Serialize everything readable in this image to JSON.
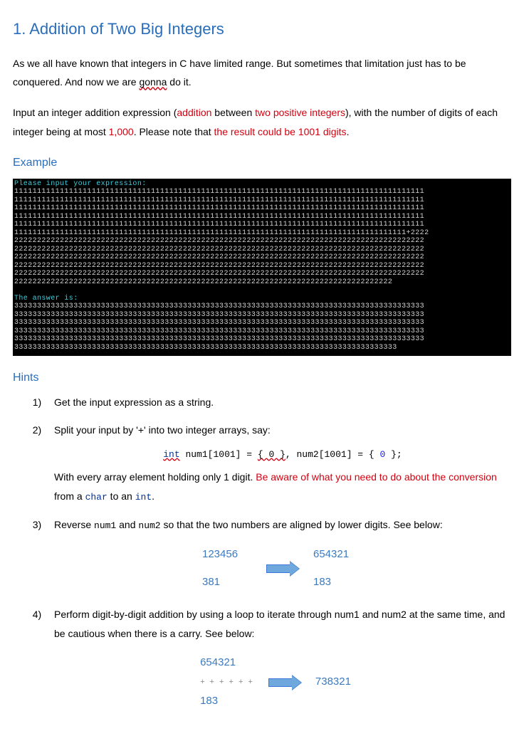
{
  "title": "1. Addition of Two Big Integers",
  "para1_a": "As we all have known that integers in C have limited range. But sometimes that limitation just has to be conquered. And now we are ",
  "para1_squiggle": "gonna",
  "para1_b": " do it.",
  "para2_a": "Input an integer addition expression (",
  "para2_red1": "addition",
  "para2_b": " between ",
  "para2_red2": "two positive integers",
  "para2_c": "), with the number of digits of each integer being at most ",
  "para2_red3": "1,000",
  "para2_d": ". Please note that ",
  "para2_red4": "the result could be 1001 digits",
  "para2_e": ".",
  "example_heading": "Example",
  "terminal": {
    "line_prompt": "Please input your expression:",
    "ones": "111111111111111111111111111111111111111111111111111111111111111111111111111111111111111111\n111111111111111111111111111111111111111111111111111111111111111111111111111111111111111111\n111111111111111111111111111111111111111111111111111111111111111111111111111111111111111111\n111111111111111111111111111111111111111111111111111111111111111111111111111111111111111111\n111111111111111111111111111111111111111111111111111111111111111111111111111111111111111111\n11111111111111111111111111111111111111111111111111111111111111111111111111111111111111+2222\n222222222222222222222222222222222222222222222222222222222222222222222222222222222222222222\n222222222222222222222222222222222222222222222222222222222222222222222222222222222222222222\n222222222222222222222222222222222222222222222222222222222222222222222222222222222222222222\n222222222222222222222222222222222222222222222222222222222222222222222222222222222222222222\n222222222222222222222222222222222222222222222222222222222222222222222222222222222222222222\n22222222222222222222222222222222222222222222222222222222222222222222222222222222222",
    "line_answer": "The answer is:",
    "threes": "333333333333333333333333333333333333333333333333333333333333333333333333333333333333333333\n333333333333333333333333333333333333333333333333333333333333333333333333333333333333333333\n333333333333333333333333333333333333333333333333333333333333333333333333333333333333333333\n333333333333333333333333333333333333333333333333333333333333333333333333333333333333333333\n333333333333333333333333333333333333333333333333333333333333333333333333333333333333333333\n333333333333333333333333333333333333333333333333333333333333333333333333333333333333"
  },
  "hints_heading": "Hints",
  "hints": {
    "h1": "Get the input expression as a string.",
    "h2_a": "Split your input by '+' into two integer arrays, say:",
    "h2_code_kw": "int",
    "h2_code_a": " num1[1001] = ",
    "h2_code_brace": "{ 0 }",
    "h2_code_b": ", num2[1001] = { ",
    "h2_code_zero": "0",
    "h2_code_c": " };",
    "h2_b": "With every array element holding only 1 digit. ",
    "h2_red": "Be aware of what you need to do about the conversion",
    "h2_c": " from a ",
    "h2_char": "char",
    "h2_d": " to an ",
    "h2_int": "int",
    "h2_e": ".",
    "h3_a": "Reverse ",
    "h3_num1": "num1",
    "h3_b": " and ",
    "h3_num2": "num2",
    "h3_c": " so that the two numbers are aligned by lower digits. See below:",
    "diag1": {
      "l1": "123456",
      "l2": "381",
      "r1": "654321",
      "r2": "183"
    },
    "h4": "Perform digit-by-digit addition by using a loop to iterate through num1 and num2 at the same time, and be cautious when there is a carry. See below:",
    "diag2": {
      "l1": "654321",
      "dots": "+ + + + + +",
      "l2": "183",
      "r1": "738321"
    }
  }
}
